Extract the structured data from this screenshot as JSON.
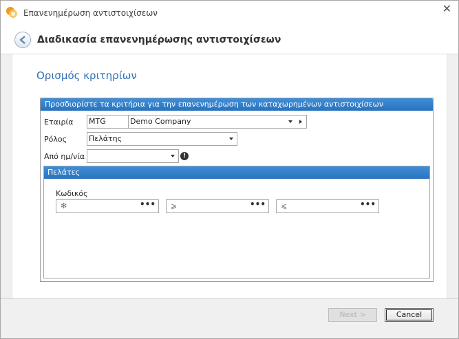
{
  "window": {
    "title": "Επανενημέρωση αντιστοιχίσεων"
  },
  "header": {
    "title": "Διαδικασία επανενημέρωσης αντιστοιχίσεων"
  },
  "section": {
    "title": "Ορισμός κριτηρίων"
  },
  "criteria_group": {
    "header": "Προσδιορίστε τα κριτήρια για την επανενημέρωση των καταχωρημένων αντιστοιχίσεων",
    "company_label": "Εταιρία",
    "company_code": "MTG",
    "company_name": "Demo Company",
    "role_label": "Ρόλος",
    "role_value": "Πελάτης",
    "date_label": "Από ημ/νία",
    "date_value": ""
  },
  "customers_group": {
    "header": "Πελάτες",
    "code_label": "Κωδικός",
    "fields": [
      {
        "icon": "asterisk-icon",
        "glyph": "✻",
        "value": ""
      },
      {
        "icon": "greater-equal-icon",
        "glyph": "⩾",
        "value": ""
      },
      {
        "icon": "less-equal-icon",
        "glyph": "⩽",
        "value": ""
      }
    ],
    "dots": "•••"
  },
  "buttons": {
    "next": "Next >",
    "cancel": "Cancel"
  },
  "colors": {
    "accent": "#2c6fb5",
    "header_bar": "#3182cc"
  }
}
